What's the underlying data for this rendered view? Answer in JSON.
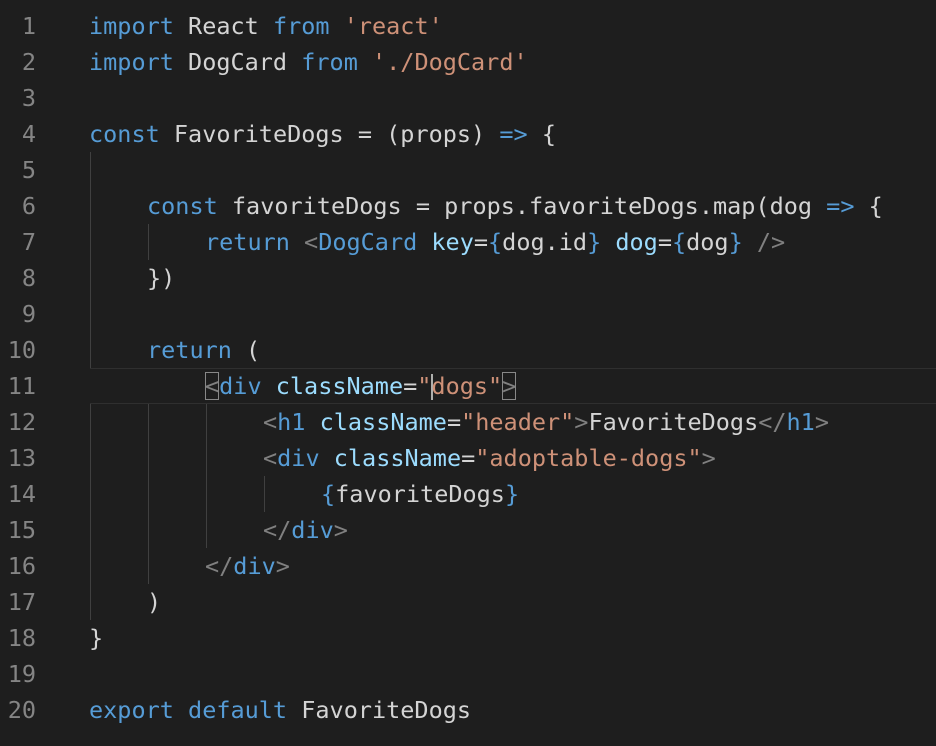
{
  "editor": {
    "line_numbers": [
      "1",
      "2",
      "3",
      "4",
      "5",
      "6",
      "7",
      "8",
      "9",
      "10",
      "11",
      "12",
      "13",
      "14",
      "15",
      "16",
      "17",
      "18",
      "19",
      "20"
    ]
  },
  "colors": {
    "background": "#1e1e1e",
    "keyword": "#569cd6",
    "string": "#ce9178",
    "attribute": "#9cdcfe",
    "text": "#d4d4d4",
    "line_number": "#858585"
  },
  "tokens": {
    "l1": [
      "import",
      "React",
      "from",
      "'react'"
    ],
    "l2": [
      "import",
      "DogCard",
      "from",
      "'./DogCard'"
    ],
    "l4": [
      "const",
      "FavoriteDogs",
      "=",
      "(props)",
      "=>",
      "{"
    ],
    "l6": [
      "const",
      "favoriteDogs",
      "=",
      "props.favoriteDogs.map(dog",
      "=>",
      "{"
    ],
    "l7": [
      "return",
      "<",
      "DogCard",
      "key",
      "=",
      "{",
      "dog.id",
      "}",
      "dog",
      "=",
      "{",
      "dog",
      "}",
      "/>"
    ],
    "l8": "})",
    "l10": [
      "return",
      "("
    ],
    "l11": [
      "<",
      "div",
      "className",
      "=",
      "\"",
      "dogs\"",
      ">"
    ],
    "l12": [
      "<",
      "h1",
      "className",
      "=",
      "\"header\"",
      ">",
      "FavoriteDogs",
      "</",
      "h1",
      ">"
    ],
    "l13": [
      "<",
      "div",
      "className",
      "=",
      "\"adoptable-dogs\"",
      ">"
    ],
    "l14": [
      "{",
      "favoriteDogs",
      "}"
    ],
    "l15": [
      "</",
      "div",
      ">"
    ],
    "l16": [
      "</",
      "div",
      ">"
    ],
    "l17": ")",
    "l18": "}",
    "l20": [
      "export",
      "default",
      "FavoriteDogs"
    ]
  }
}
